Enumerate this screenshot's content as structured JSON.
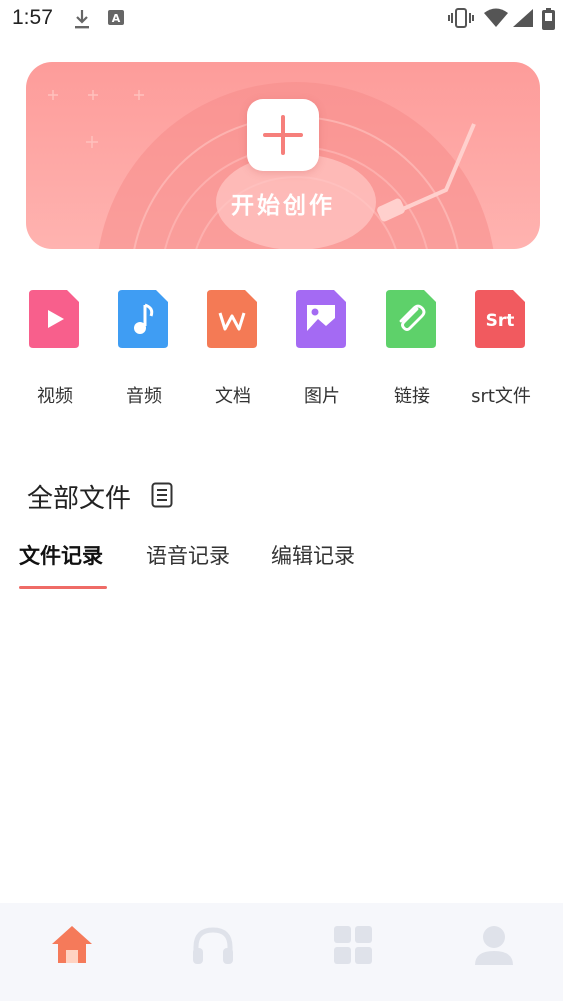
{
  "status_bar": {
    "time": "1:57",
    "icons": [
      "download-icon",
      "font-a-icon",
      "vibrate-icon",
      "wifi-icon",
      "signal-icon",
      "battery-icon"
    ]
  },
  "banner": {
    "label": "开始创作",
    "icon": "plus-icon"
  },
  "quick_actions": [
    {
      "label": "视频",
      "icon": "video-file-icon",
      "color": "#f85f8c"
    },
    {
      "label": "音频",
      "icon": "audio-file-icon",
      "color": "#3f9df3"
    },
    {
      "label": "文档",
      "icon": "document-file-icon",
      "color": "#f47a55"
    },
    {
      "label": "图片",
      "icon": "image-file-icon",
      "color": "#a46af3"
    },
    {
      "label": "链接",
      "icon": "link-file-icon",
      "color": "#5ed16a"
    },
    {
      "label": "srt文件",
      "icon": "srt-file-icon",
      "color": "#f15a5f",
      "icon_text": "Srt"
    }
  ],
  "section": {
    "title": "全部文件",
    "icon": "list-icon"
  },
  "tabs": [
    {
      "label": "文件记录",
      "active": true
    },
    {
      "label": "语音记录",
      "active": false
    },
    {
      "label": "编辑记录",
      "active": false
    }
  ],
  "bottom_nav": [
    {
      "icon": "home-icon",
      "active": true
    },
    {
      "icon": "headphones-icon",
      "active": false
    },
    {
      "icon": "grid-icon",
      "active": false
    },
    {
      "icon": "profile-icon",
      "active": false
    }
  ],
  "colors": {
    "accent": "#ef6b66",
    "banner": "#fd9c9a",
    "nav_inactive": "#dfe2ea",
    "nav_bg": "#f6f7fb"
  }
}
